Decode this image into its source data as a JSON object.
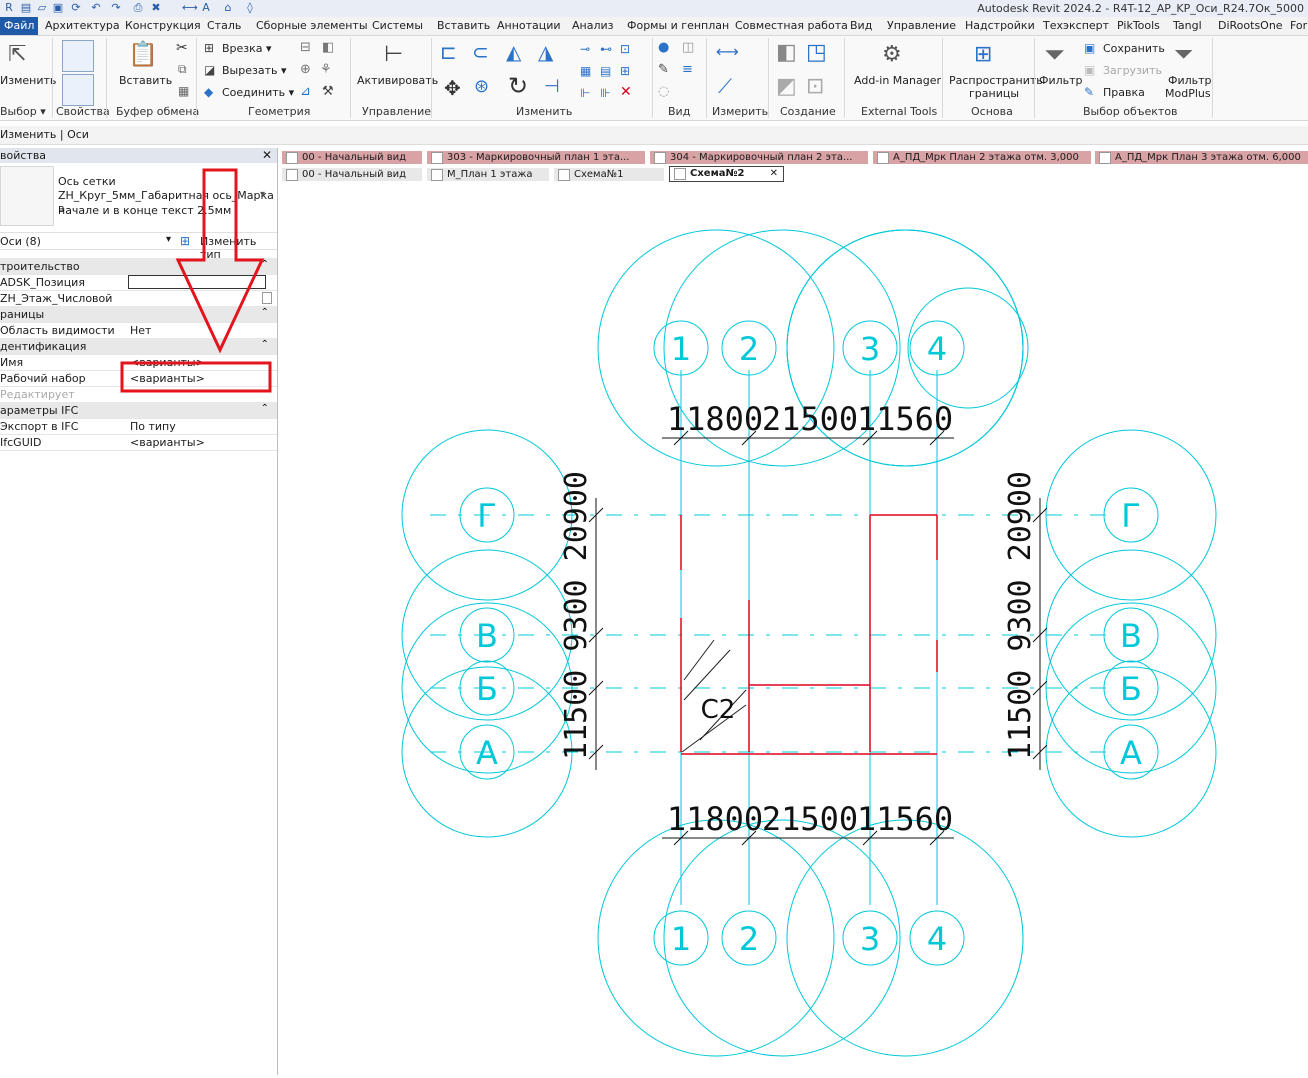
{
  "app": {
    "title": "Autodesk Revit 2024.2 - R4T-12_AP_KP_Оси_R24.7Ок_5000"
  },
  "ribbon_tabs": [
    "Файл",
    "Архитектура",
    "Конструкция",
    "Сталь",
    "Сборные элементы",
    "Системы",
    "Вставить",
    "Аннотации",
    "Анализ",
    "Формы и генплан",
    "Совместная работа",
    "Вид",
    "Управление",
    "Надстройки",
    "Техэксперт",
    "PikTools",
    "Tangl",
    "DiRootsOne",
    "For"
  ],
  "ribbon": {
    "select": {
      "modify": "Изменить",
      "title": "Выбор ▾"
    },
    "properties": {
      "title": "Свойства"
    },
    "clipboard": {
      "paste": "Вставить",
      "title": "Буфер обмена"
    },
    "geometry": {
      "cut_in": "Врезка ▾",
      "cut": "Вырезать ▾",
      "join": "Соединить ▾",
      "title": "Геометрия"
    },
    "control": {
      "activate": "Активировать",
      "title": "Управление"
    },
    "modify": {
      "title": "Изменить"
    },
    "view": {
      "title": "Вид"
    },
    "measure": {
      "title": "Измерить"
    },
    "create": {
      "title": "Создание"
    },
    "external": {
      "addin": "Add-in Manager",
      "title": "External Tools"
    },
    "basis": {
      "spread": "Распространить",
      "spread2": "границы",
      "title": "Основа"
    },
    "selection": {
      "filter": "Фильтр",
      "save": "Сохранить",
      "load": "Загрузить",
      "edit": "Правка",
      "modplus1": "Фильтр",
      "modplus2": "ModPlus",
      "title": "Выбор объектов"
    }
  },
  "options_bar": {
    "text": "Изменить | Оси"
  },
  "properties": {
    "header": "войства",
    "type_name_line1": "Ось сетки",
    "type_name_line2": "ZH_Круг_5мм_Габаритная ось_Марка в",
    "type_name_line3": "начале и в конце текст 2.5мм",
    "selector": "Оси (8)",
    "edit_type": "Изменить тип",
    "rows": [
      {
        "k": "троительство",
        "v": "",
        "cat": true
      },
      {
        "k": "ADSK_Позиция",
        "v": "",
        "cat": false
      },
      {
        "k": "ZH_Этаж_Числовой",
        "v": "",
        "cat": false
      },
      {
        "k": "раницы",
        "v": "",
        "cat": true
      },
      {
        "k": "Область видимости",
        "v": "Нет",
        "cat": false
      },
      {
        "k": "дентификация",
        "v": "",
        "cat": true
      },
      {
        "k": "Имя",
        "v": "<варианты>",
        "cat": false
      },
      {
        "k": "Рабочий набор",
        "v": "<варианты>",
        "cat": false
      },
      {
        "k": "Редактирует",
        "v": "",
        "cat": false,
        "dim": true
      },
      {
        "k": "араметры IFC",
        "v": "",
        "cat": true
      },
      {
        "k": "Экспорт в IFC",
        "v": "По типу",
        "cat": false
      },
      {
        "k": "IfcGUID",
        "v": "<варианты>",
        "cat": false
      }
    ]
  },
  "doc_tabs": {
    "row1": [
      "00 - Начальный вид",
      "303 - Маркировочный план 1 эта...",
      "304 - Маркировочный план 2 эта...",
      "А_ПД_Мрк План 2 этажа отм. 3,000",
      "А_ПД_Мрк План 3 этажа отм. 6,000"
    ],
    "row2": [
      "00 - Начальный вид",
      "М_План 1 этажа",
      "Схема№1",
      "Схема№2"
    ]
  },
  "drawing": {
    "col_markers": [
      "1",
      "2",
      "3",
      "4"
    ],
    "row_markers": [
      "Г",
      "В",
      "Б",
      "А"
    ],
    "dim_horizontal": [
      "11800",
      "21500",
      "11560"
    ],
    "dim_vertical": "11500 9300 20900",
    "section_label": "С2",
    "grid_color": "#00c8d8",
    "wall_color": "#e0001c"
  },
  "annotation_color": "#e3141c"
}
